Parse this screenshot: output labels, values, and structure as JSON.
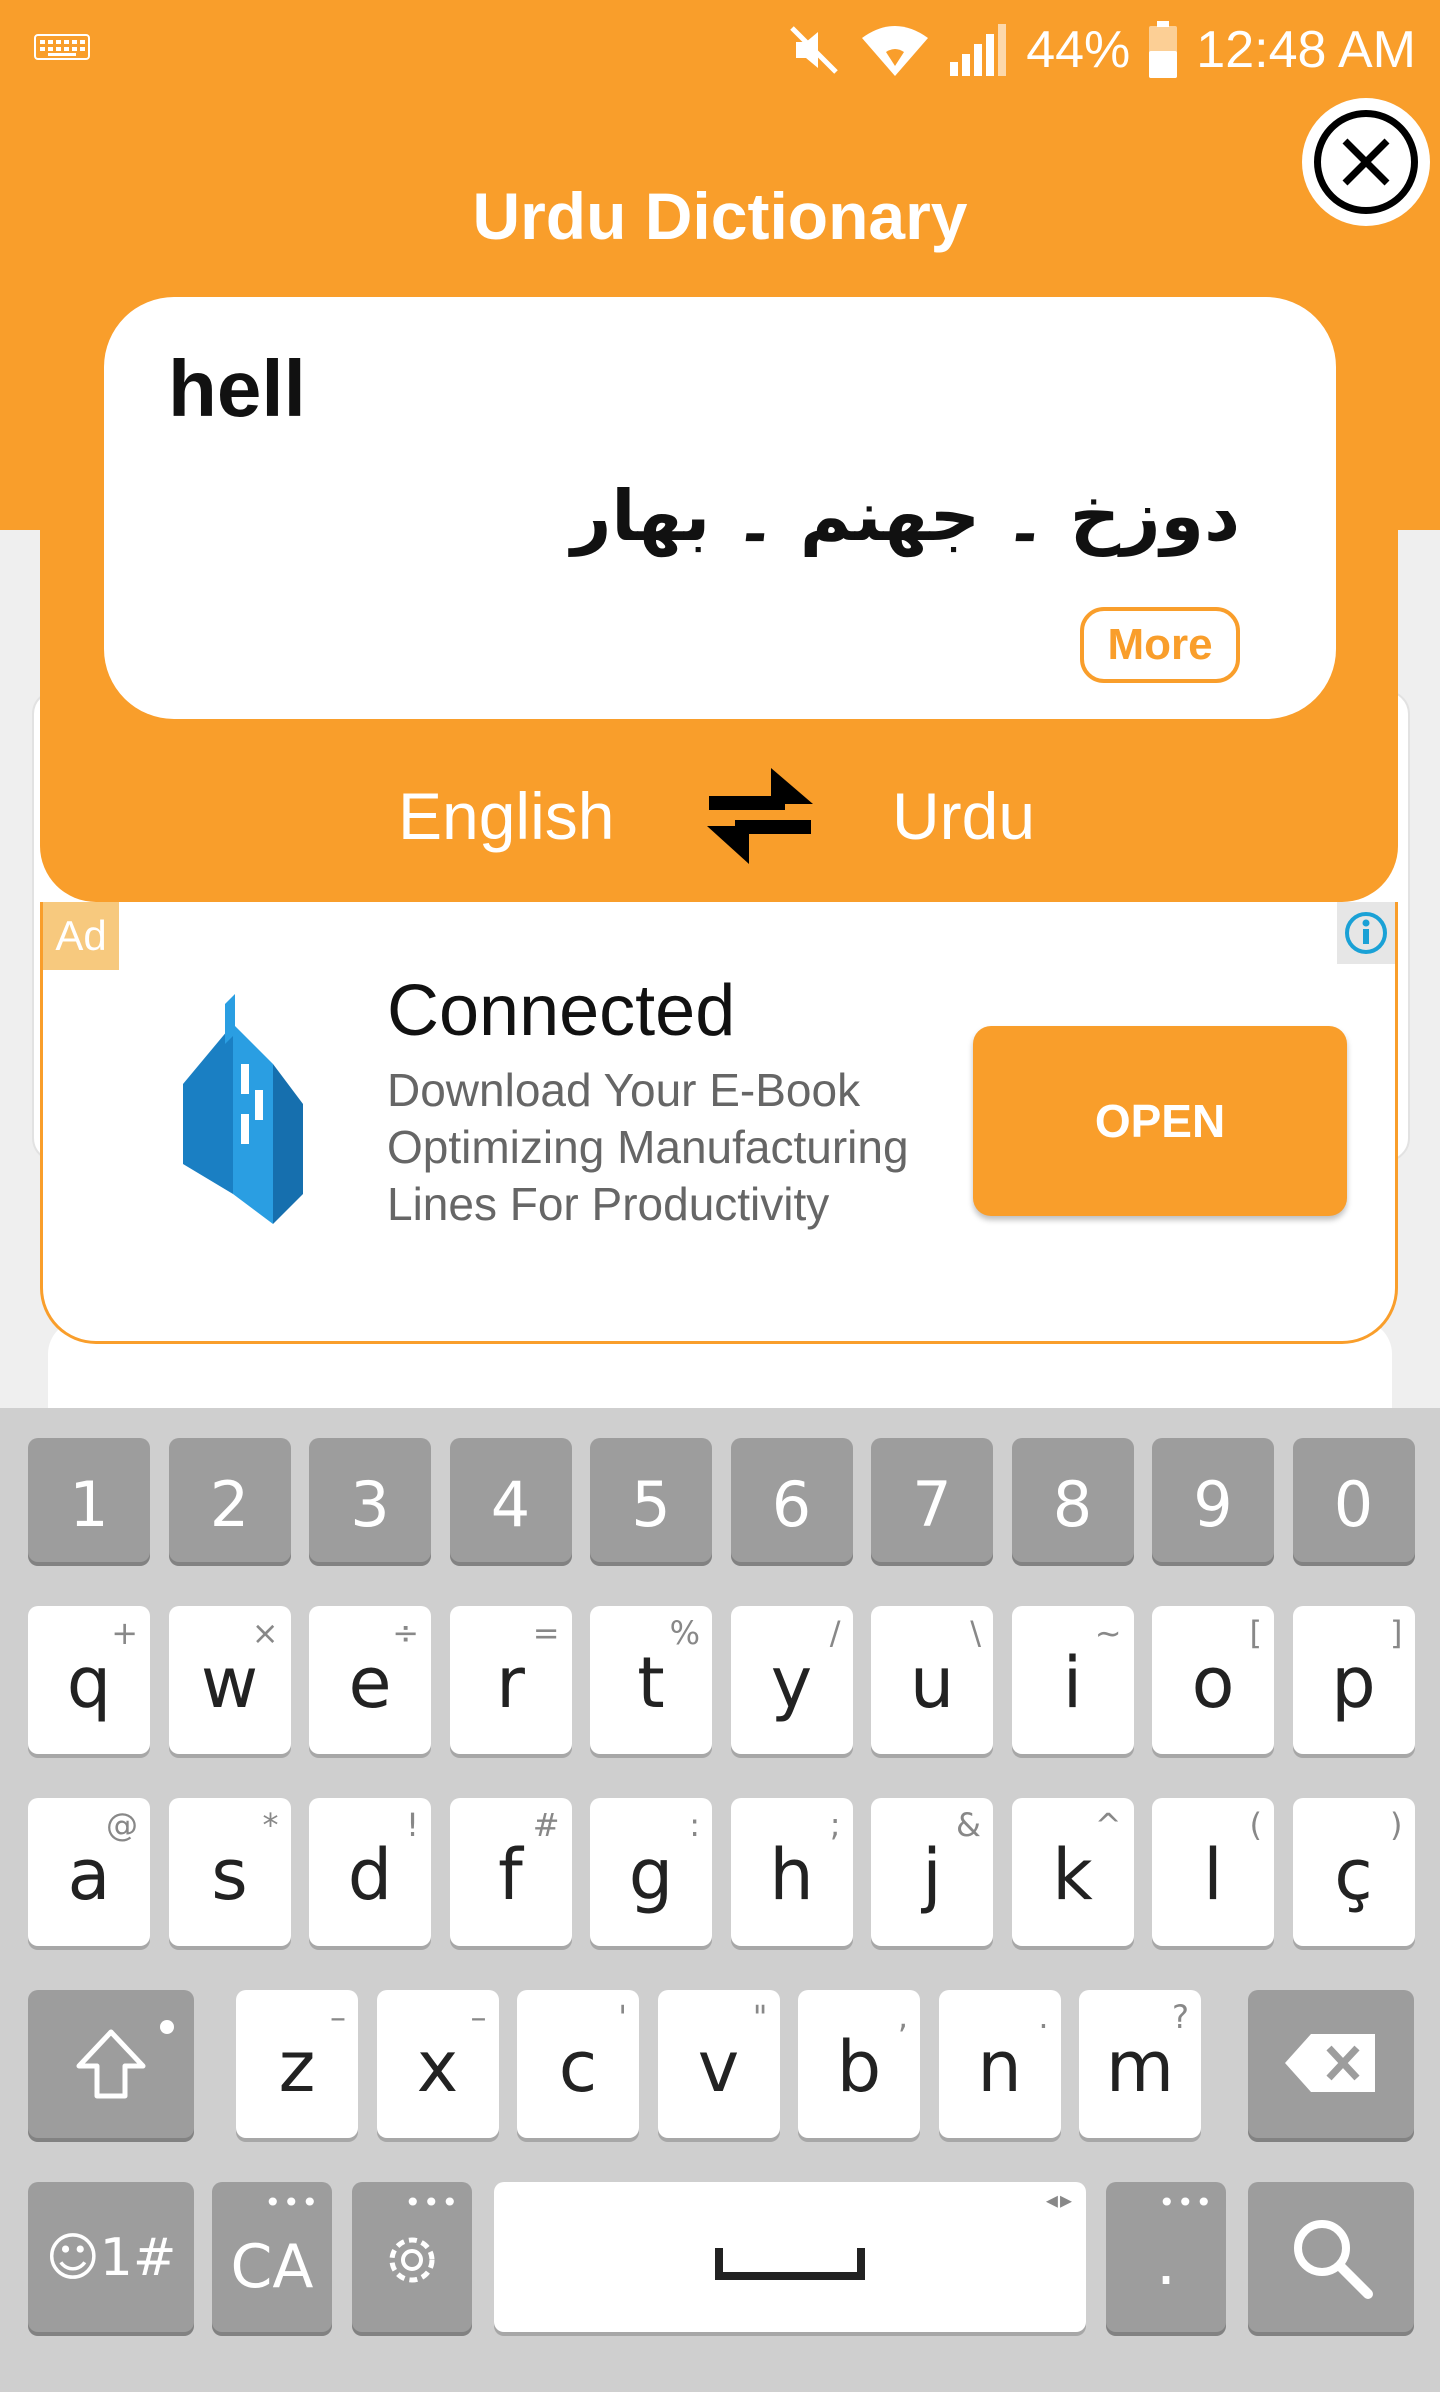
{
  "status_bar": {
    "battery": "44%",
    "time": "12:48 AM"
  },
  "app": {
    "title": "Urdu Dictionary"
  },
  "result": {
    "word": "hell",
    "translation": "دوزخ ۔ جهنم ۔ بهار",
    "more_label": "More"
  },
  "languages": {
    "from": "English",
    "to": "Urdu"
  },
  "ad": {
    "badge": "Ad",
    "title": "Connected",
    "description": "Download Your E-Book Optimizing Manufacturing Lines For Productivity",
    "cta": "OPEN"
  },
  "keyboard": {
    "numbers": [
      "1",
      "2",
      "3",
      "4",
      "5",
      "6",
      "7",
      "8",
      "9",
      "0"
    ],
    "row1": [
      {
        "k": "q",
        "s": "+"
      },
      {
        "k": "w",
        "s": "×"
      },
      {
        "k": "e",
        "s": "÷"
      },
      {
        "k": "r",
        "s": "="
      },
      {
        "k": "t",
        "s": "%"
      },
      {
        "k": "y",
        "s": "/"
      },
      {
        "k": "u",
        "s": "\\"
      },
      {
        "k": "i",
        "s": "~"
      },
      {
        "k": "o",
        "s": "["
      },
      {
        "k": "p",
        "s": "]"
      }
    ],
    "row2": [
      {
        "k": "a",
        "s": "@"
      },
      {
        "k": "s",
        "s": "*"
      },
      {
        "k": "d",
        "s": "!"
      },
      {
        "k": "f",
        "s": "#"
      },
      {
        "k": "g",
        "s": ":"
      },
      {
        "k": "h",
        "s": ";"
      },
      {
        "k": "j",
        "s": "&"
      },
      {
        "k": "k",
        "s": "^"
      },
      {
        "k": "l",
        "s": "("
      },
      {
        "k": "ç",
        "s": ")"
      }
    ],
    "row3": [
      {
        "k": "z",
        "s": "–"
      },
      {
        "k": "x",
        "s": "–"
      },
      {
        "k": "c",
        "s": "'"
      },
      {
        "k": "v",
        "s": "\""
      },
      {
        "k": "b",
        "s": ","
      },
      {
        "k": "n",
        "s": "."
      },
      {
        "k": "m",
        "s": "?"
      }
    ],
    "symbols_label": "☺1#",
    "lang_label": "CA",
    "period_label": "."
  }
}
